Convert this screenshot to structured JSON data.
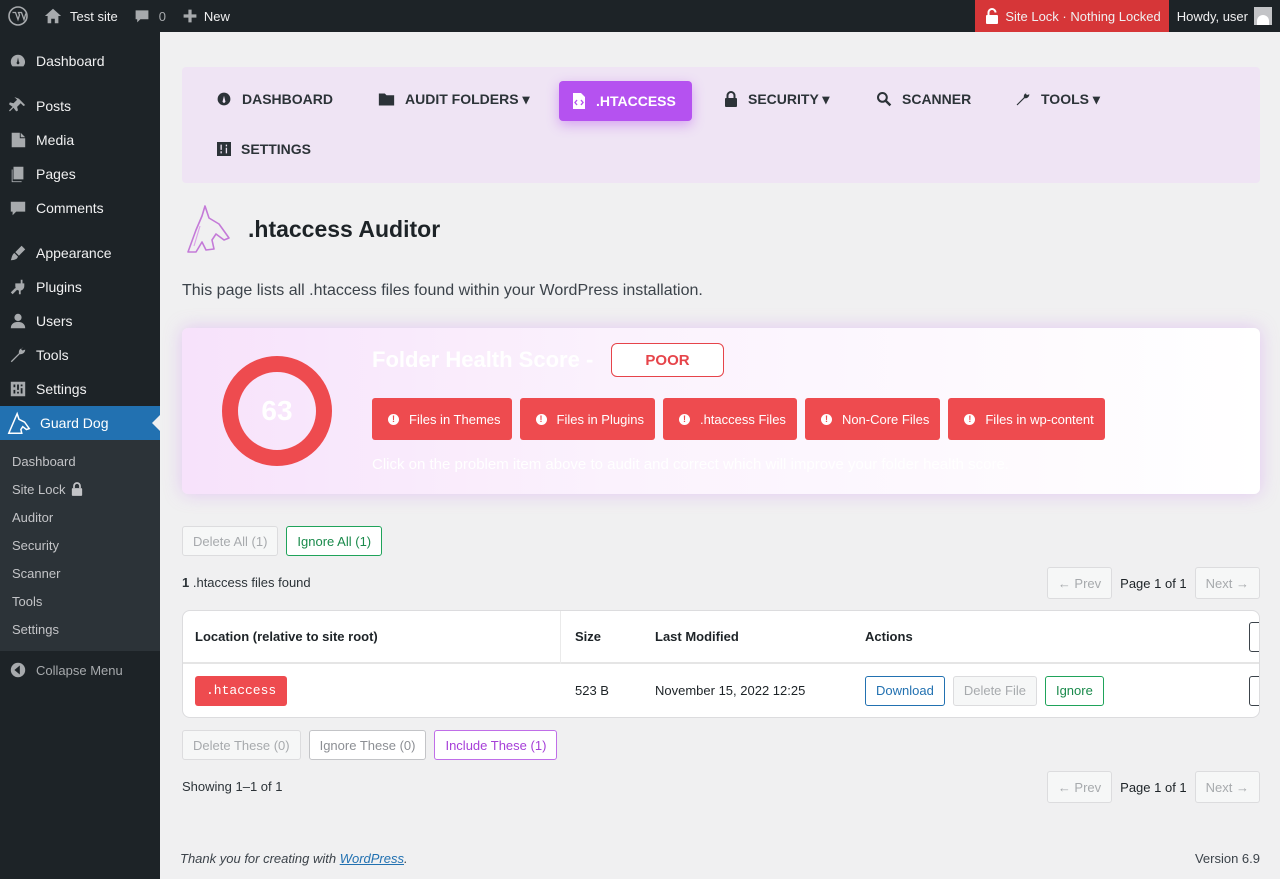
{
  "adminbar": {
    "site_name": "Test site",
    "comments_count": "0",
    "new_label": "New",
    "site_lock_label": "Site Lock · Nothing Locked",
    "howdy": "Howdy, user"
  },
  "sidebar": {
    "items": [
      {
        "label": "Dashboard",
        "icon": "dashboard-icon"
      },
      {
        "label": "Posts",
        "icon": "pin-icon"
      },
      {
        "label": "Media",
        "icon": "media-icon"
      },
      {
        "label": "Pages",
        "icon": "pages-icon"
      },
      {
        "label": "Comments",
        "icon": "comment-icon"
      },
      {
        "label": "Appearance",
        "icon": "brush-icon"
      },
      {
        "label": "Plugins",
        "icon": "plug-icon"
      },
      {
        "label": "Users",
        "icon": "user-icon"
      },
      {
        "label": "Tools",
        "icon": "wrench-icon"
      },
      {
        "label": "Settings",
        "icon": "settings-icon"
      },
      {
        "label": "Guard Dog",
        "icon": "guard-dog-icon"
      }
    ],
    "submenu": [
      "Dashboard",
      "Site Lock",
      "Auditor",
      "Security",
      "Scanner",
      "Tools",
      "Settings"
    ],
    "collapse": "Collapse Menu"
  },
  "nav": {
    "dashboard": "DASHBOARD",
    "audit_folders": "AUDIT FOLDERS ▾",
    "htaccess": ".HTACCESS",
    "security": "SECURITY ▾",
    "scanner": "SCANNER",
    "tools": "TOOLS ▾",
    "settings": "SETTINGS"
  },
  "page": {
    "title": ".htaccess Auditor",
    "description": "This page lists all .htaccess files found within your WordPress installation."
  },
  "health": {
    "score": "63",
    "title": "Folder Health Score -",
    "rating": "POOR",
    "problems": [
      "Files in Themes",
      "Files in Plugins",
      ".htaccess Files",
      "Non-Core Files",
      "Files in wp-content"
    ],
    "hint": "Click on the problem item above to audit and correct which will improve your folder health score.",
    "accent": "#ee4b4f"
  },
  "bulk": {
    "delete_all": "Delete All (1)",
    "ignore_all": "Ignore All (1)",
    "delete_these": "Delete These (0)",
    "ignore_these": "Ignore These (0)",
    "include_these": "Include These (1)"
  },
  "summary": {
    "count": "1",
    "found_text": " .htaccess files found",
    "showing": "Showing 1–1 of 1"
  },
  "pager": {
    "prev": "← Prev",
    "page": "Page 1 of 1",
    "next": "Next →"
  },
  "table": {
    "headers": [
      "Location (relative to site root)",
      "Size",
      "Last Modified",
      "Actions"
    ],
    "rows": [
      {
        "location": ".htaccess",
        "size": "523 B",
        "modified": "November 15, 2022 12:25",
        "download": "Download",
        "delete": "Delete File",
        "ignore": "Ignore"
      }
    ]
  },
  "footer": {
    "thanks": "Thank you for creating with ",
    "link": "WordPress",
    "version": "Version 6.9"
  }
}
